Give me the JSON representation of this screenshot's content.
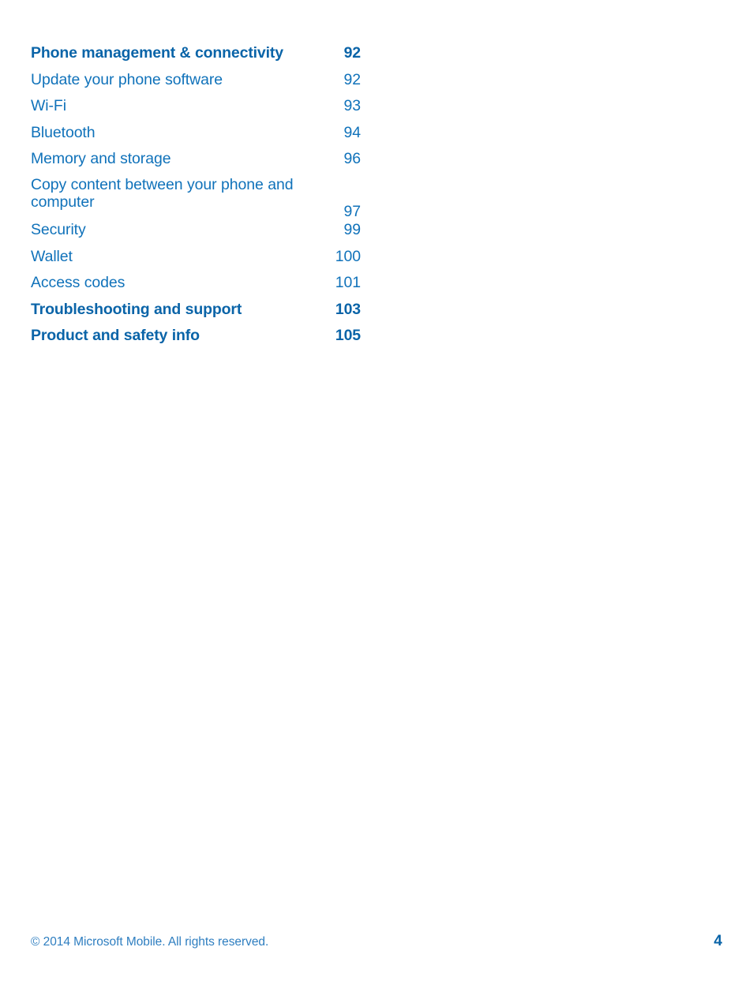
{
  "document": {
    "type": "table-of-contents",
    "page_number": "4",
    "colors": {
      "heading_blue": "#0A64A8",
      "entry_blue": "#1072BA",
      "footer_blue": "#2E7EC0",
      "background": "#FFFFFF"
    }
  },
  "toc": {
    "entries": [
      {
        "title": "Phone management & connectivity",
        "page": "92",
        "level": 1,
        "wrapped": false
      },
      {
        "title": "Update your phone software",
        "page": "92",
        "level": 2,
        "wrapped": false
      },
      {
        "title": "Wi-Fi",
        "page": "93",
        "level": 2,
        "wrapped": false
      },
      {
        "title": "Bluetooth",
        "page": "94",
        "level": 2,
        "wrapped": false
      },
      {
        "title": "Memory and storage",
        "page": "96",
        "level": 2,
        "wrapped": false
      },
      {
        "title": "Copy content between your phone and computer",
        "page": "97",
        "level": 2,
        "wrapped": true
      },
      {
        "title": "Security",
        "page": "99",
        "level": 2,
        "wrapped": false
      },
      {
        "title": "Wallet",
        "page": "100",
        "level": 2,
        "wrapped": false
      },
      {
        "title": "Access codes",
        "page": "101",
        "level": 2,
        "wrapped": false
      },
      {
        "title": "Troubleshooting and support",
        "page": "103",
        "level": 1,
        "wrapped": false
      },
      {
        "title": "Product and safety info",
        "page": "105",
        "level": 1,
        "wrapped": false
      }
    ]
  },
  "footer": {
    "copyright": "© 2014 Microsoft Mobile. All rights reserved.",
    "page_number": "4"
  }
}
